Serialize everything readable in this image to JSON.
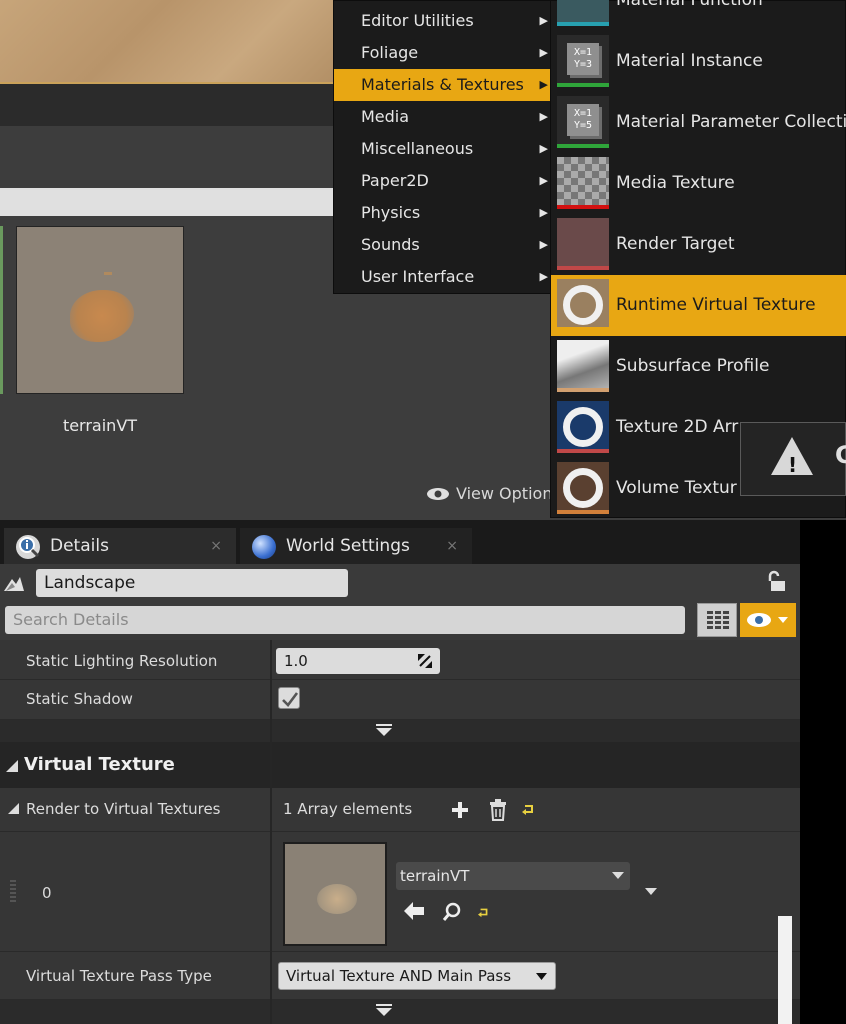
{
  "submenu_categories": [
    "Editor Utilities",
    "Foliage",
    "Materials & Textures",
    "Media",
    "Miscellaneous",
    "Paper2D",
    "Physics",
    "Sounds",
    "User Interface"
  ],
  "submenu_selected": "Materials & Textures",
  "asset_types": [
    {
      "label": "Material Function",
      "bar": "#27a0b0"
    },
    {
      "label": "Material Instance",
      "bar": "#2fa53a"
    },
    {
      "label": "Material Parameter Collectio",
      "bar": "#2fa53a"
    },
    {
      "label": "Media Texture",
      "bar": "#d21010"
    },
    {
      "label": "Render Target",
      "bar": "#c04848"
    },
    {
      "label": "Runtime Virtual Texture",
      "bar": "#e8a713"
    },
    {
      "label": "Subsurface Profile",
      "bar": "#d2a070"
    },
    {
      "label": "Texture 2D Arr",
      "bar": "#c04848"
    },
    {
      "label": "Volume Textur",
      "bar": "#d2803a"
    }
  ],
  "asset_selected": "Runtime Virtual Texture",
  "content_browser": {
    "asset_name": "terrainVT",
    "view_options": "View Option"
  },
  "warning": {
    "letter": "C"
  },
  "tabs": {
    "details": "Details",
    "world_settings": "World Settings",
    "close": "×"
  },
  "object": {
    "name": "Landscape"
  },
  "search": {
    "placeholder": "Search Details"
  },
  "properties": {
    "static_lighting_resolution": {
      "label": "Static Lighting Resolution",
      "value": "1.0"
    },
    "static_shadow": {
      "label": "Static Shadow",
      "checked": true
    },
    "category": "Virtual Texture",
    "render_to_vt": {
      "label": "Render to Virtual Textures",
      "count": "1 Array elements"
    },
    "element": {
      "index": "0",
      "asset": "terrainVT"
    },
    "pass_type": {
      "label": "Virtual Texture Pass Type",
      "value": "Virtual Texture AND Main Pass"
    }
  },
  "colors": {
    "accent": "#e8a713",
    "panel": "#363636",
    "menu": "#1b1b1b"
  }
}
